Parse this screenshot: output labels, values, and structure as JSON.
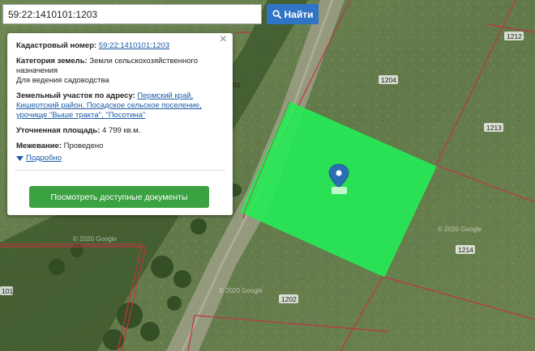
{
  "search": {
    "value": "59:22:1410101:1203",
    "button_label": "Найти",
    "icon": "search-icon"
  },
  "popup": {
    "close_symbol": "×",
    "cadastral_label": "Кадастровый номер:",
    "cadastral_value": "59:22:1410101:1203",
    "category_label": "Категория земель:",
    "category_value": "Земли сельскохозяйственного назначения",
    "usage_value": "Для ведения садоводства",
    "address_label": "Земельный участок по адресу:",
    "address_value": "Пермский край, Кишертский район, Посадское сельское поселение, урочище \"Выше тракта\", \"Посотина\"",
    "area_label": "Уточненная площадь:",
    "area_value": "4 799 кв.м.",
    "survey_label": "Межевание:",
    "survey_value": "Проведено",
    "more_label": "Подробно",
    "docs_button": "Посмотреть доступные документы"
  },
  "map": {
    "plot_labels": {
      "p1204": "1204",
      "p1212": "1212",
      "p1213": "1213",
      "p1214": "1214",
      "p1202": "1202",
      "p101a": "01",
      "p101b": "101"
    },
    "selected_plot_color": "#22ee55",
    "boundary_color": "#c0353f",
    "marker_color": "#2a6fb4",
    "watermark": "© 2020 Google"
  }
}
